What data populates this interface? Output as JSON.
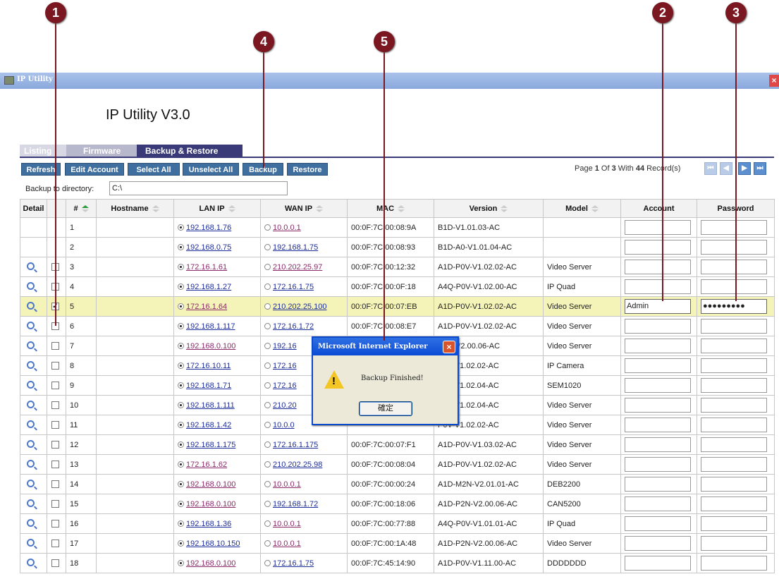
{
  "callouts": [
    "1",
    "2",
    "3",
    "4",
    "5"
  ],
  "window": {
    "title": "IP Utility",
    "close_glyph": "×"
  },
  "app_heading": "IP Utility V3.0",
  "tabs": [
    {
      "label": "Listing",
      "active": false
    },
    {
      "label": "Firmware",
      "active": false
    },
    {
      "label": "Backup & Restore",
      "active": true
    }
  ],
  "toolbar": {
    "refresh": "Refresh",
    "edit_account": "Edit Account",
    "select_all": "Select All",
    "unselect_all": "Unselect All",
    "backup": "Backup",
    "restore": "Restore"
  },
  "pager": {
    "text_prefix": "Page ",
    "page": "1",
    "text_mid": " Of ",
    "total_pages": "3",
    "text_with": " With ",
    "record_count": "44",
    "text_suffix": " Record(s)",
    "first_glyph": "⏮",
    "prev_glyph": "◀",
    "next_glyph": "▶",
    "last_glyph": "⏭"
  },
  "backup_dir": {
    "label": "Backup to directory:",
    "value": "C:\\"
  },
  "columns": {
    "detail": "Detail",
    "num": "#",
    "hostname": "Hostname",
    "lan_ip": "LAN IP",
    "wan_ip": "WAN IP",
    "mac": "MAC",
    "version": "Version",
    "model": "Model",
    "account": "Account",
    "password": "Password"
  },
  "rows": [
    {
      "num": "1",
      "lan_ip": "192.168.1.76",
      "wan_ip": "10.0.0.1",
      "mac": "00:0F:7C:00:08:9A",
      "version": "B1D-V1.01.03-AC",
      "model": "",
      "account": "",
      "password": "",
      "has_detail": false,
      "checked": false,
      "lan_visited": false,
      "wan_visited": true
    },
    {
      "num": "2",
      "lan_ip": "192.168.0.75",
      "wan_ip": "192.168.1.75",
      "mac": "00:0F:7C:00:08:93",
      "version": "B1D-A0-V1.01.04-AC",
      "model": "",
      "account": "",
      "password": "",
      "has_detail": false,
      "checked": false,
      "lan_visited": false,
      "wan_visited": false
    },
    {
      "num": "3",
      "lan_ip": "172.16.1.61",
      "wan_ip": "210.202.25.97",
      "mac": "00:0F:7C:00:12:32",
      "version": "A1D-P0V-V1.02.02-AC",
      "model": "Video Server",
      "account": "",
      "password": "",
      "has_detail": true,
      "checked": false,
      "lan_visited": true,
      "wan_visited": true
    },
    {
      "num": "4",
      "lan_ip": "192.168.1.27",
      "wan_ip": "172.16.1.75",
      "mac": "00:0F:7C:00:0F:18",
      "version": "A4Q-P0V-V1.02.00-AC",
      "model": "IP Quad",
      "account": "",
      "password": "",
      "has_detail": true,
      "checked": false,
      "lan_visited": false,
      "wan_visited": false
    },
    {
      "num": "5",
      "lan_ip": "172.16.1.64",
      "wan_ip": "210.202.25.100",
      "mac": "00:0F:7C:00:07:EB",
      "version": "A1D-P0V-V1.02.02-AC",
      "model": "Video Server",
      "account": "Admin",
      "password": "●●●●●●●●●",
      "has_detail": true,
      "checked": true,
      "lan_visited": true,
      "wan_visited": false
    },
    {
      "num": "6",
      "lan_ip": "192.168.1.117",
      "wan_ip": "172.16.1.72",
      "mac": "00:0F:7C:00:08:E7",
      "version": "A1D-P0V-V1.02.02-AC",
      "model": "Video Server",
      "account": "",
      "password": "",
      "has_detail": true,
      "checked": false,
      "lan_visited": false,
      "wan_visited": false
    },
    {
      "num": "7",
      "lan_ip": "192.168.0.100",
      "wan_ip": "192.16",
      "mac": "",
      "version": "P2N-V2.00.06-AC",
      "model": "Video Server",
      "account": "",
      "password": "",
      "has_detail": true,
      "checked": false,
      "lan_visited": true,
      "wan_visited": false
    },
    {
      "num": "8",
      "lan_ip": "172.16.10.11",
      "wan_ip": "172.16",
      "mac": "",
      "version": "P0V-V1.02.02-AC",
      "model": "IP Camera",
      "account": "",
      "password": "",
      "has_detail": true,
      "checked": false,
      "lan_visited": false,
      "wan_visited": false
    },
    {
      "num": "9",
      "lan_ip": "192.168.1.71",
      "wan_ip": "172.16",
      "mac": "",
      "version": "P0V-V1.02.04-AC",
      "model": "SEM1020",
      "account": "",
      "password": "",
      "has_detail": true,
      "checked": false,
      "lan_visited": false,
      "wan_visited": false
    },
    {
      "num": "10",
      "lan_ip": "192.168.1.111",
      "wan_ip": "210.20",
      "mac": "",
      "version": "P0V-V1.02.04-AC",
      "model": "Video Server",
      "account": "",
      "password": "",
      "has_detail": true,
      "checked": false,
      "lan_visited": false,
      "wan_visited": false
    },
    {
      "num": "11",
      "lan_ip": "192.168.1.42",
      "wan_ip": "10.0.0",
      "mac": "",
      "version": "P0V-V1.02.02-AC",
      "model": "Video Server",
      "account": "",
      "password": "",
      "has_detail": true,
      "checked": false,
      "lan_visited": false,
      "wan_visited": false
    },
    {
      "num": "12",
      "lan_ip": "192.168.1.175",
      "wan_ip": "172.16.1.175",
      "mac": "00:0F:7C:00:07:F1",
      "version": "A1D-P0V-V1.03.02-AC",
      "model": "Video Server",
      "account": "",
      "password": "",
      "has_detail": true,
      "checked": false,
      "lan_visited": false,
      "wan_visited": false
    },
    {
      "num": "13",
      "lan_ip": "172.16.1.62",
      "wan_ip": "210.202.25.98",
      "mac": "00:0F:7C:00:08:04",
      "version": "A1D-P0V-V1.02.02-AC",
      "model": "Video Server",
      "account": "",
      "password": "",
      "has_detail": true,
      "checked": false,
      "lan_visited": true,
      "wan_visited": false
    },
    {
      "num": "14",
      "lan_ip": "192.168.0.100",
      "wan_ip": "10.0.0.1",
      "mac": "00:0F:7C:00:00:24",
      "version": "A1D-M2N-V2.01.01-AC",
      "model": "DEB2200",
      "account": "",
      "password": "",
      "has_detail": true,
      "checked": false,
      "lan_visited": true,
      "wan_visited": true
    },
    {
      "num": "15",
      "lan_ip": "192.168.0.100",
      "wan_ip": "192.168.1.72",
      "mac": "00:0F:7C:00:18:06",
      "version": "A1D-P2N-V2.00.06-AC",
      "model": "CAN5200",
      "account": "",
      "password": "",
      "has_detail": true,
      "checked": false,
      "lan_visited": true,
      "wan_visited": false
    },
    {
      "num": "16",
      "lan_ip": "192.168.1.36",
      "wan_ip": "10.0.0.1",
      "mac": "00:0F:7C:00:77:88",
      "version": "A4Q-P0V-V1.01.01-AC",
      "model": "IP Quad",
      "account": "",
      "password": "",
      "has_detail": true,
      "checked": false,
      "lan_visited": false,
      "wan_visited": true
    },
    {
      "num": "17",
      "lan_ip": "192.168.10.150",
      "wan_ip": "10.0.0.1",
      "mac": "00:0F:7C:00:1A:48",
      "version": "A1D-P2N-V2.00.06-AC",
      "model": "Video Server",
      "account": "",
      "password": "",
      "has_detail": true,
      "checked": false,
      "lan_visited": false,
      "wan_visited": true
    },
    {
      "num": "18",
      "lan_ip": "192.168.0.100",
      "wan_ip": "172.16.1.75",
      "mac": "00:0F:7C:45:14:90",
      "version": "A1D-P0V-V1.11.00-AC",
      "model": "DDDDDDD",
      "account": "",
      "password": "",
      "has_detail": true,
      "checked": false,
      "lan_visited": true,
      "wan_visited": false
    }
  ],
  "dialog": {
    "title": "Microsoft Internet Explorer",
    "close_glyph": "×",
    "message": "Backup Finished!",
    "warning_glyph": "!",
    "ok_label": "確定"
  }
}
